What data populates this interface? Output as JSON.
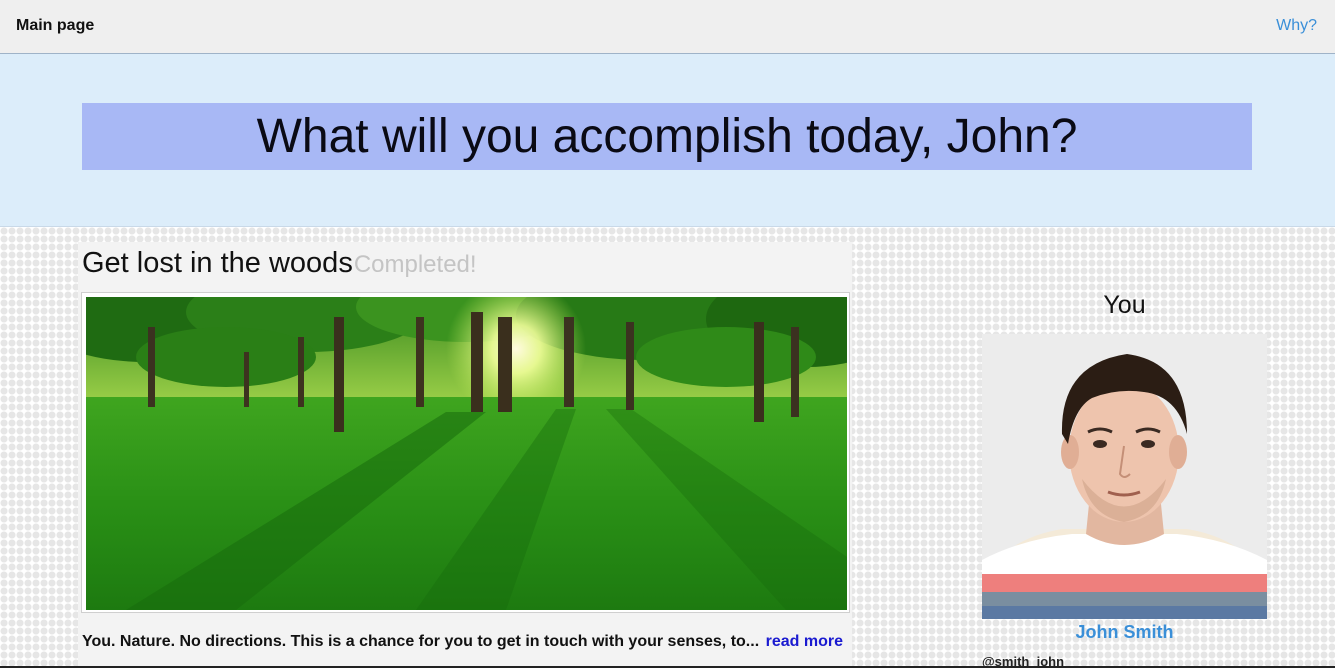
{
  "nav": {
    "home_label": "Main page",
    "why_label": "Why?"
  },
  "hero": {
    "headline": "What will you accomplish today, John?"
  },
  "challenge": {
    "title": "Get lost in the woods",
    "status": "Completed!",
    "description": "You. Nature. No directions. This is a chance for you to get in touch with your senses, to...",
    "read_more_label": "read more"
  },
  "profile": {
    "heading": "You",
    "name": "John Smith",
    "handle": "@smith_john"
  },
  "colors": {
    "topbar_bg": "#efefef",
    "hero_bg": "#dcedfa",
    "headline_box": "#a8b8f5",
    "link_blue": "#3a8fd8",
    "read_more_blue": "#1a1ad0",
    "completed_gray": "#c4c4c4"
  }
}
